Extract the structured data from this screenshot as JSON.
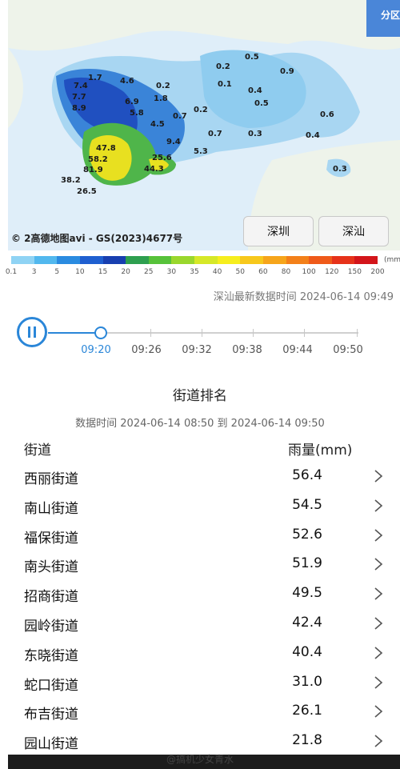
{
  "map": {
    "split_tab": "分区",
    "copyright": "© 2高德地图avi - GS(2023)4677号",
    "buttons": [
      "深圳",
      "深汕"
    ],
    "values": [
      {
        "text": "1.7"
      },
      {
        "text": "7.4"
      },
      {
        "text": "7.7"
      },
      {
        "text": "8.9"
      },
      {
        "text": "4.6"
      },
      {
        "text": "0.2"
      },
      {
        "text": "1.8"
      },
      {
        "text": "6.9"
      },
      {
        "text": "5.8"
      },
      {
        "text": "4.5"
      },
      {
        "text": "0.7"
      },
      {
        "text": "0.2"
      },
      {
        "text": "47.8"
      },
      {
        "text": "58.2"
      },
      {
        "text": "81.9"
      },
      {
        "text": "38.2"
      },
      {
        "text": "26.5"
      },
      {
        "text": "44.3"
      },
      {
        "text": "25.6"
      },
      {
        "text": "9.4"
      },
      {
        "text": "5.3"
      },
      {
        "text": "0.7"
      },
      {
        "text": "0.3"
      },
      {
        "text": "0.2"
      },
      {
        "text": "0.5"
      },
      {
        "text": "0.1"
      },
      {
        "text": "0.4"
      },
      {
        "text": "0.5"
      },
      {
        "text": "0.9"
      },
      {
        "text": "0.6"
      },
      {
        "text": "0.4"
      },
      {
        "text": "0.3"
      }
    ]
  },
  "legend": {
    "unit": "(mm",
    "ticks": [
      "0.1",
      "3",
      "5",
      "10",
      "15",
      "20",
      "25",
      "30",
      "35",
      "40",
      "50",
      "60",
      "80",
      "100",
      "120",
      "150",
      "200"
    ],
    "colors": [
      "#8fd3f4",
      "#52b8ee",
      "#2a8be0",
      "#1f5fd0",
      "#183fb0",
      "#2e9f4f",
      "#57c23a",
      "#9ad72d",
      "#d6e828",
      "#f6ee1e",
      "#f7c81c",
      "#f6a51b",
      "#f3801a",
      "#ef5a1a",
      "#e6321a",
      "#d3151a"
    ]
  },
  "latest_time": "深汕最新数据时间 2024-06-14 09:49",
  "timeline": {
    "labels": [
      "09:20",
      "09:26",
      "09:32",
      "09:38",
      "09:44",
      "09:50"
    ],
    "active_index": 0
  },
  "ranking": {
    "title": "街道排名",
    "range": "数据时间 2024-06-14 08:50 到 2024-06-14 09:50",
    "col_street": "街道",
    "col_rain": "雨量(mm)",
    "rows": [
      {
        "street": "西丽街道",
        "value": "56.4"
      },
      {
        "street": "南山街道",
        "value": "54.5"
      },
      {
        "street": "福保街道",
        "value": "52.6"
      },
      {
        "street": "南头街道",
        "value": "51.9"
      },
      {
        "street": "招商街道",
        "value": "49.5"
      },
      {
        "street": "园岭街道",
        "value": "42.4"
      },
      {
        "street": "东晓街道",
        "value": "40.4"
      },
      {
        "street": "蛇口街道",
        "value": "31.0"
      },
      {
        "street": "布吉街道",
        "value": "26.1"
      },
      {
        "street": "园山街道",
        "value": "21.8"
      }
    ]
  },
  "watermark": "@搞机少女青水"
}
